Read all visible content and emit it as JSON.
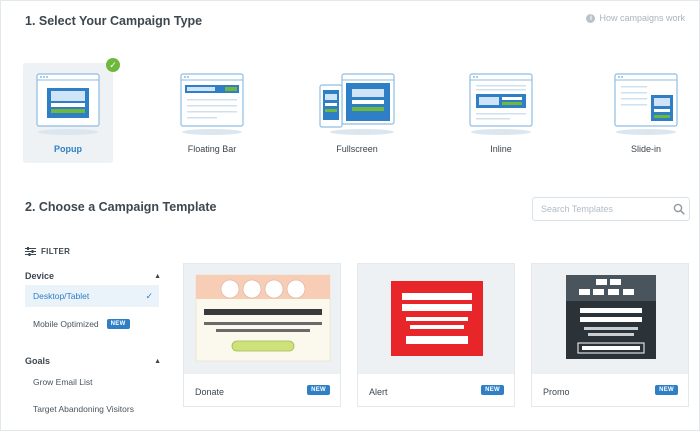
{
  "section1": {
    "title": "1. Select Your Campaign Type",
    "how_link": "How campaigns work",
    "types": [
      {
        "label": "Popup",
        "selected": true
      },
      {
        "label": "Floating Bar",
        "selected": false
      },
      {
        "label": "Fullscreen",
        "selected": false
      },
      {
        "label": "Inline",
        "selected": false
      },
      {
        "label": "Slide-in",
        "selected": false
      }
    ]
  },
  "section2": {
    "title": "2. Choose a Campaign Template",
    "search_placeholder": "Search Templates"
  },
  "filter": {
    "label": "FILTER",
    "device": {
      "title": "Device",
      "options": [
        {
          "label": "Desktop/Tablet",
          "selected": true
        },
        {
          "label": "Mobile Optimized",
          "badge": "NEW"
        }
      ]
    },
    "goals": {
      "title": "Goals",
      "options": [
        {
          "label": "Grow Email List"
        },
        {
          "label": "Target Abandoning Visitors"
        }
      ]
    }
  },
  "templates": [
    {
      "name": "Donate",
      "badge": "NEW"
    },
    {
      "name": "Alert",
      "badge": "NEW"
    },
    {
      "name": "Promo",
      "badge": "NEW"
    }
  ],
  "colors": {
    "accent": "#2f7fc6",
    "success": "#6fb83c",
    "alert_red": "#e8262a",
    "donate_peach": "#f8cdb6",
    "promo_dark": "#2c3338"
  }
}
